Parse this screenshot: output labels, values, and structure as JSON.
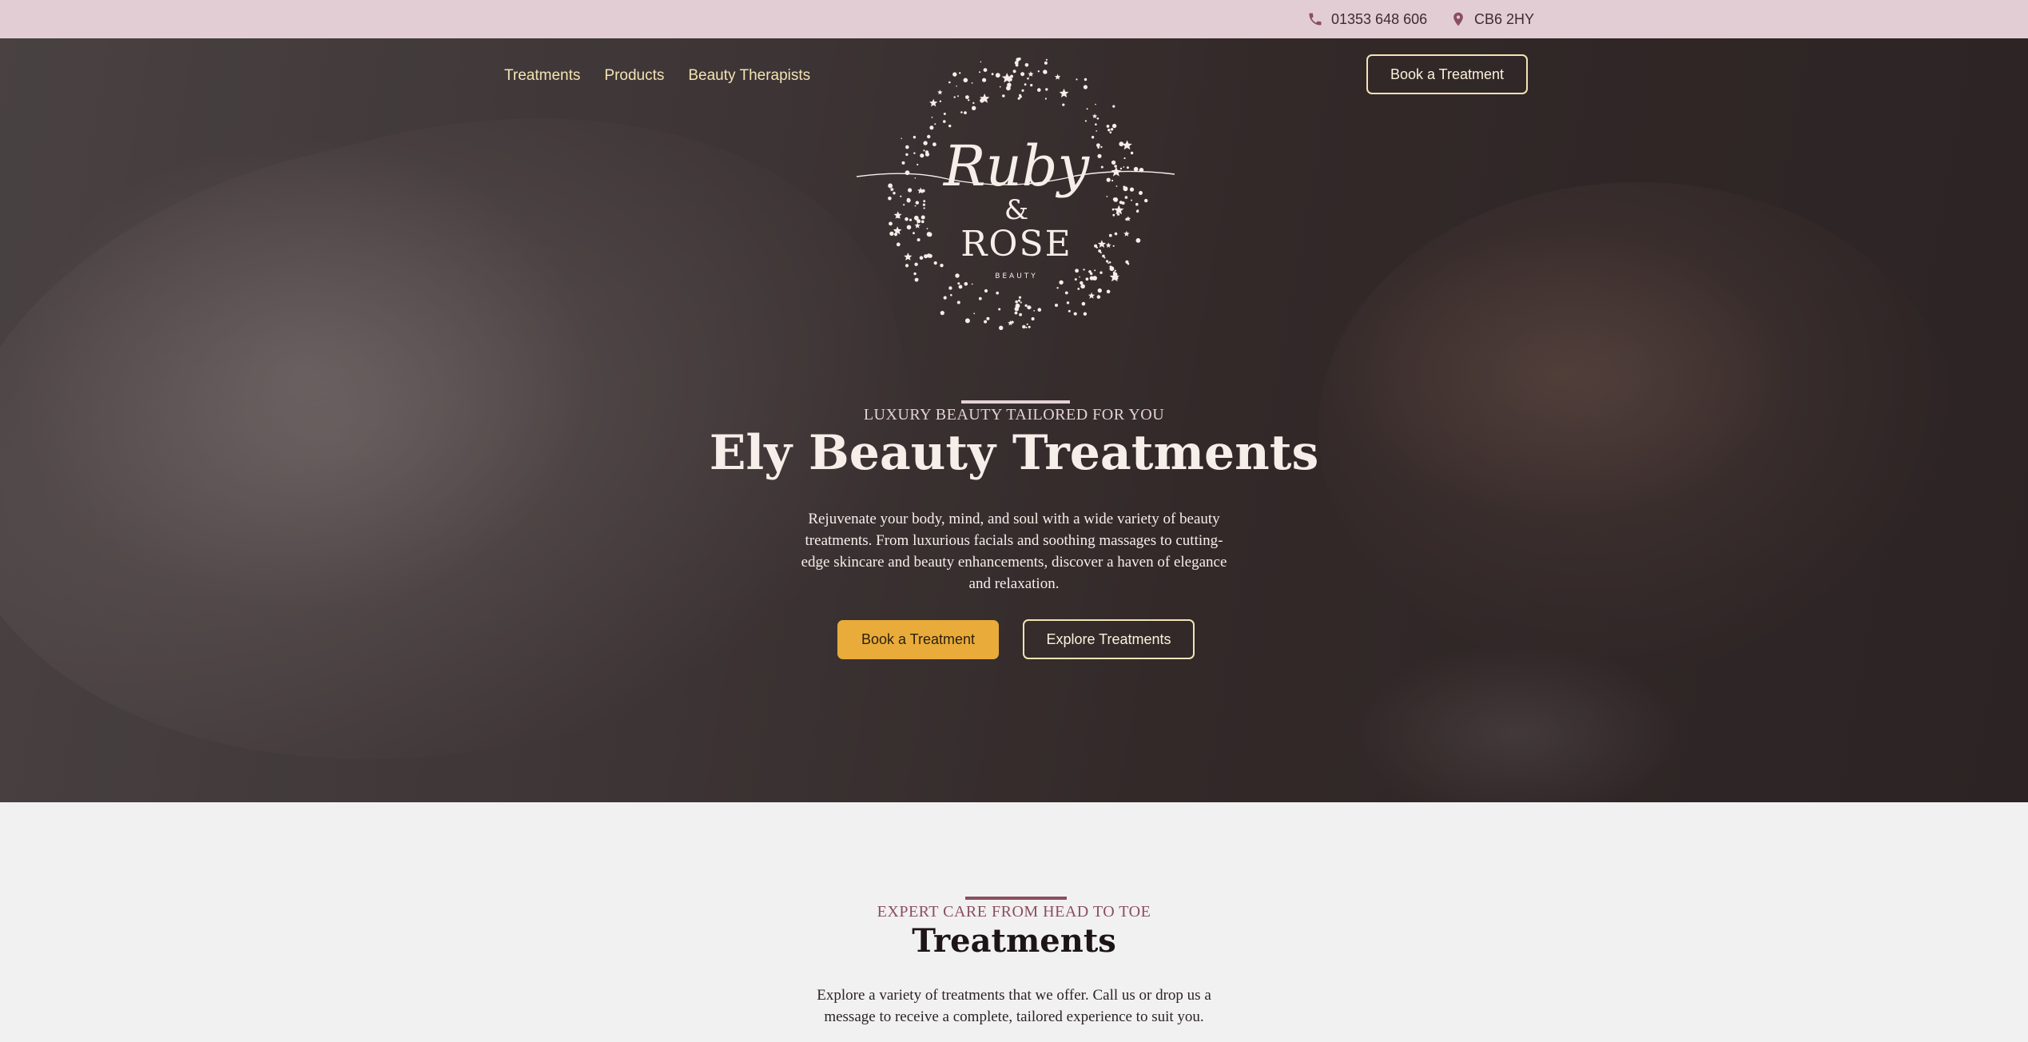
{
  "topbar": {
    "phone": "01353 648 606",
    "phone_icon": "phone-icon",
    "location": "CB6 2HY",
    "location_icon": "map-pin-icon"
  },
  "nav": {
    "items": [
      "Treatments",
      "Products",
      "Beauty Therapists"
    ],
    "book_button": "Book a Treatment"
  },
  "logo": {
    "script": "Ruby",
    "ampersand": "&",
    "name": "ROSE",
    "tagline": "BEAUTY"
  },
  "hero": {
    "eyebrow": "LUXURY BEAUTY TAILORED FOR YOU",
    "title": "Ely Beauty Treatments",
    "description": "Rejuvenate your body, mind, and soul with a wide variety of beauty treatments. From luxurious facials and soothing massages to cutting-edge skincare and beauty enhancements, discover a haven of elegance and relaxation.",
    "primary_button": "Book a Treatment",
    "secondary_button": "Explore Treatments"
  },
  "treatments_section": {
    "eyebrow": "EXPERT CARE FROM HEAD TO TOE",
    "title": "Treatments",
    "description": "Explore a variety of treatments that we offer. Call us or drop us a message to receive a complete, tailored experience to suit you."
  },
  "colors": {
    "topbar_bg": "#e3cdd5",
    "accent_gold": "#e9ac3a",
    "nav_text": "#f4e3b4",
    "plum": "#8a4e60"
  }
}
